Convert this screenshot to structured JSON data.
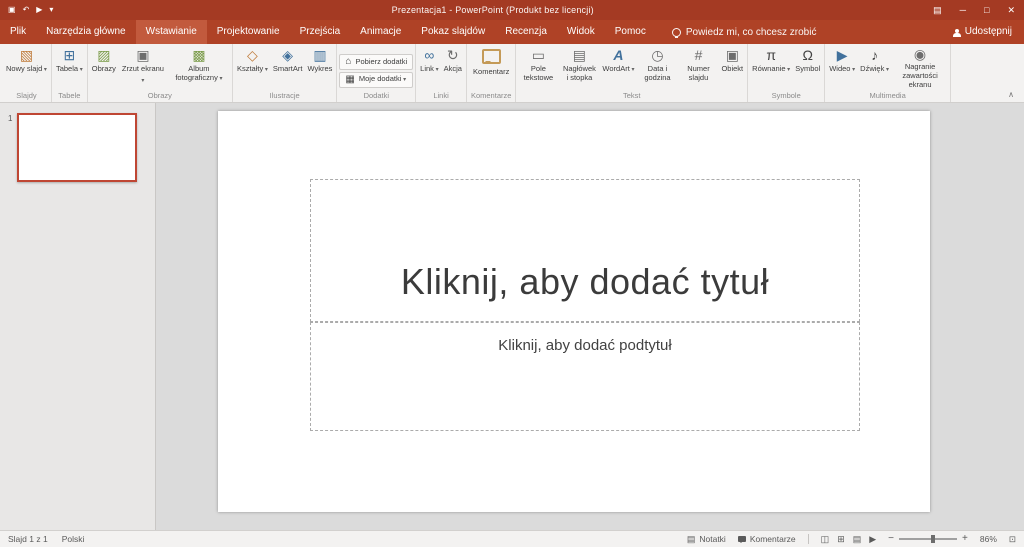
{
  "colors": {
    "accent_red": "#b7472a",
    "titlebar": "#a43a23",
    "tab_active": "#c25a3d",
    "ribbon_bg": "#f3f2f1",
    "selected_thumb_border": "#bf4633"
  },
  "titlebar": {
    "title": "Prezentacja1 - PowerPoint (Produkt bez licencji)",
    "qat": {
      "save_icon": "▣",
      "undo_icon": "↶",
      "present_icon": "▶",
      "customize_icon": "▾"
    },
    "window": {
      "ribbon_options_icon": "▤",
      "minimize_icon": "─",
      "maximize_icon": "□",
      "close_icon": "✕"
    }
  },
  "tabs": {
    "file": "Plik",
    "items": [
      "Narzędzia główne",
      "Wstawianie",
      "Projektowanie",
      "Przejścia",
      "Animacje",
      "Pokaz slajdów",
      "Recenzja",
      "Widok",
      "Pomoc"
    ],
    "active": "Wstawianie",
    "tell_me": "Powiedz mi, co chcesz zrobić",
    "share": "Udostępnij"
  },
  "ribbon": {
    "collapse_icon": "∧",
    "groups": [
      {
        "label": "Slajdy",
        "buttons": [
          {
            "label": "Nowy slajd",
            "icon": "▧"
          }
        ]
      },
      {
        "label": "Tabele",
        "buttons": [
          {
            "label": "Tabela",
            "icon": "⊞"
          }
        ]
      },
      {
        "label": "Obrazy",
        "buttons": [
          {
            "label": "Obrazy",
            "icon": "▨"
          },
          {
            "label": "Zrzut ekranu",
            "icon": "▣"
          },
          {
            "label": "Album fotograficzny",
            "icon": "▩"
          }
        ]
      },
      {
        "label": "Ilustracje",
        "buttons": [
          {
            "label": "Kształty",
            "icon": "◇"
          },
          {
            "label": "SmartArt",
            "icon": "◈"
          },
          {
            "label": "Wykres",
            "icon": "▥"
          }
        ]
      },
      {
        "label": "Dodatki",
        "buttons": [
          {
            "label": "Pobierz dodatki",
            "icon": "⌂"
          },
          {
            "label": "Moje dodatki",
            "icon": "▦"
          }
        ]
      },
      {
        "label": "Linki",
        "buttons": [
          {
            "label": "Link",
            "icon": "∞"
          },
          {
            "label": "Akcja",
            "icon": "↻"
          }
        ]
      },
      {
        "label": "Komentarze",
        "buttons": [
          {
            "label": "Komentarz",
            "icon": ""
          }
        ]
      },
      {
        "label": "Tekst",
        "buttons": [
          {
            "label": "Pole tekstowe",
            "icon": "▭"
          },
          {
            "label": "Nagłówek i stopka",
            "icon": "▤"
          },
          {
            "label": "WordArt",
            "icon": "A"
          },
          {
            "label": "Data i godzina",
            "icon": "◷"
          },
          {
            "label": "Numer slajdu",
            "icon": "#"
          },
          {
            "label": "Obiekt",
            "icon": "▣"
          }
        ]
      },
      {
        "label": "Symbole",
        "buttons": [
          {
            "label": "Równanie",
            "icon": "π"
          },
          {
            "label": "Symbol",
            "icon": "Ω"
          }
        ]
      },
      {
        "label": "Multimedia",
        "buttons": [
          {
            "label": "Wideo",
            "icon": "▶"
          },
          {
            "label": "Dźwięk",
            "icon": "♪"
          },
          {
            "label": "Nagranie zawartości ekranu",
            "icon": "◉"
          }
        ]
      }
    ]
  },
  "thumbnails": {
    "slide_number": "1"
  },
  "slide": {
    "title_placeholder": "Kliknij, aby dodać tytuł",
    "subtitle_placeholder": "Kliknij, aby dodać podtytuł"
  },
  "statusbar": {
    "slide_indicator": "Slajd 1 z 1",
    "language": "Polski",
    "notes_label": "Notatki",
    "comments_label": "Komentarze",
    "notes_icon": "▤",
    "view_icons": [
      "◫",
      "⊞",
      "▤",
      "▶"
    ],
    "zoom_out": "−",
    "zoom_in": "+",
    "zoom_level": "86%",
    "fit_icon": "⊡"
  }
}
